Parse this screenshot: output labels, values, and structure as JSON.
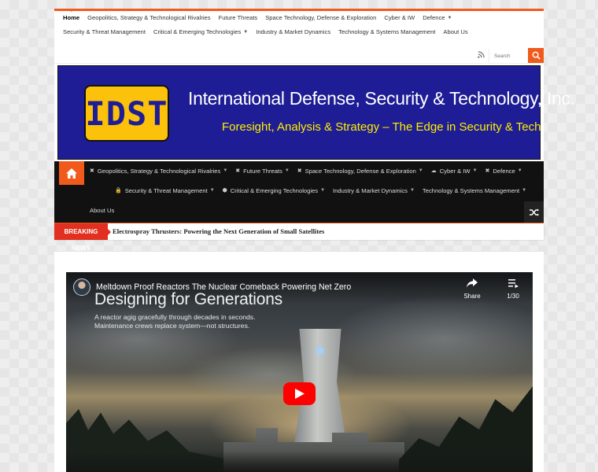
{
  "top_nav": {
    "items": [
      {
        "label": "Home",
        "active": true,
        "has_caret": false
      },
      {
        "label": "Geopolitics, Strategy & Technological Rivalries",
        "has_caret": false
      },
      {
        "label": "Future Threats",
        "has_caret": false
      },
      {
        "label": "Space Technology, Defense & Exploration",
        "has_caret": false
      },
      {
        "label": "Cyber & IW",
        "has_caret": false
      },
      {
        "label": "Defence",
        "has_caret": true
      },
      {
        "label": "Security & Threat Management",
        "has_caret": false
      },
      {
        "label": "Critical & Emerging Technologies",
        "has_caret": true
      },
      {
        "label": "Industry & Market Dynamics",
        "has_caret": false
      },
      {
        "label": "Technology & Systems Management",
        "has_caret": false
      },
      {
        "label": "About Us",
        "has_caret": false
      }
    ]
  },
  "search": {
    "placeholder": "Search",
    "icon": "search-icon",
    "rss_icon": "rss-icon"
  },
  "banner": {
    "logo_text": "IDST",
    "site_title": "International Defense, Security & Technology, Inc.",
    "tagline": "Foresight, Analysis & Strategy – The Edge in Security & Tech",
    "colors": {
      "background": "#1e1d95",
      "logo": "#fcc10a",
      "tagline": "#ffef00"
    }
  },
  "main_nav": {
    "home_icon": "home-icon",
    "items": [
      {
        "label": "Geopolitics, Strategy & Technological Rivalries",
        "icon": "✖"
      },
      {
        "label": "Future Threats",
        "icon": "✖"
      },
      {
        "label": "Space Technology, Defense & Exploration",
        "icon": "✖"
      },
      {
        "label": "Cyber & IW",
        "icon": "☁"
      },
      {
        "label": "Defence",
        "icon": "✖"
      },
      {
        "label": "Security & Threat Management",
        "icon": "🔒"
      },
      {
        "label": "Critical & Emerging Technologies",
        "icon": "⬢"
      },
      {
        "label": "Industry & Market Dynamics",
        "icon": ""
      },
      {
        "label": "Technology & Systems Management",
        "icon": ""
      },
      {
        "label": "About Us",
        "icon": ""
      }
    ],
    "shuffle_icon": "shuffle-icon",
    "accent": "#f05a1a"
  },
  "breaking": {
    "label": "BREAKING NEWS",
    "headline": "Electrospray Thrusters: Powering the Next Generation of Small Satellites"
  },
  "video": {
    "title": "Meltdown Proof Reactors The Nuclear Comeback Powering Net Zero",
    "share_label": "Share",
    "playlist_count": "1/30",
    "overlay_heading": "Designing for Generations",
    "overlay_line1": "A reactor agig gracefully through decades in seconds.",
    "overlay_line2": "Maintenance crews replace system—not structures."
  }
}
